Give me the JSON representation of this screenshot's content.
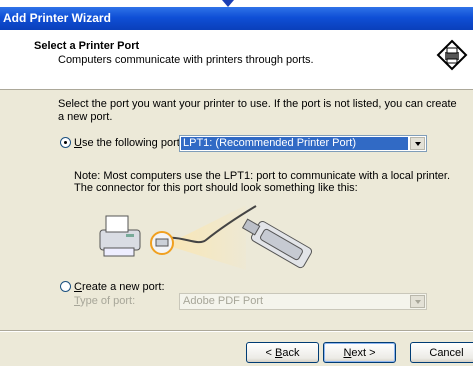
{
  "window": {
    "title": "Add Printer Wizard"
  },
  "header": {
    "title": "Select a Printer Port",
    "subtitle": "Computers communicate with printers through ports.",
    "icon": "printer-port-icon"
  },
  "instruction": "Select the port you want your printer to use.  If the port is not listed, you can create a new port.",
  "use_port": {
    "label_mnemonic": "U",
    "label_rest": "se the following port:",
    "checked": true,
    "selected_value": "LPT1: (Recommended Printer Port)"
  },
  "note": "Note: Most computers use the LPT1: port to communicate with a local printer. The connector for this port should look something like this:",
  "new_port": {
    "label_mnemonic": "C",
    "label_rest": "reate a new port:",
    "checked": false,
    "type_label_mnemonic": "T",
    "type_label_rest": "ype of port:",
    "type_value": "Adobe PDF Port"
  },
  "buttons": {
    "back_prefix": "< ",
    "back_mnemonic": "B",
    "back_rest": "ack",
    "next_mnemonic": "N",
    "next_rest": "ext >",
    "cancel": "Cancel"
  },
  "colors": {
    "titlebar": "#0f4fd6",
    "selection": "#316ac5",
    "dialog_bg": "#ece9d8"
  }
}
